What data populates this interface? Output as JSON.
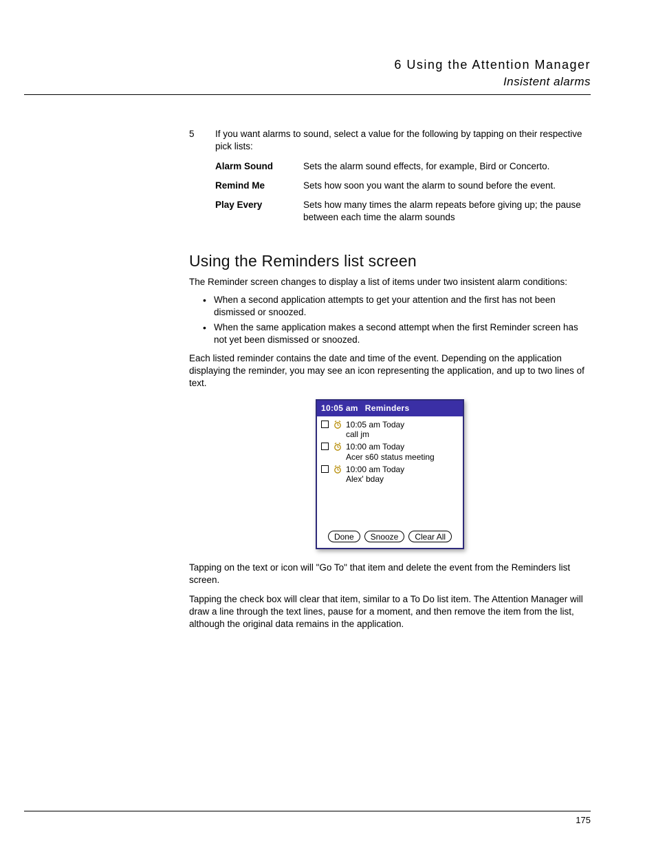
{
  "header": {
    "chapter": "6 Using the Attention Manager",
    "section": "Insistent alarms"
  },
  "step": {
    "num": "5",
    "text": "If you want alarms to sound, select a value for the following by tapping on their respective pick lists:"
  },
  "defs": [
    {
      "term": "Alarm Sound",
      "desc": "Sets the alarm sound effects, for example, Bird or Concerto."
    },
    {
      "term": "Remind Me",
      "desc": "Sets how soon you want the alarm to sound before the event."
    },
    {
      "term": "Play Every",
      "desc": "Sets how many times the alarm repeats before giving up; the pause between each time the alarm sounds"
    }
  ],
  "h2": "Using the Reminders list screen",
  "intro": "The Reminder screen changes to display a list of items under two insistent alarm conditions:",
  "bullets": [
    "When a second application attempts to get your attention and the first has not been dismissed or snoozed.",
    "When the same application makes a second attempt when the first Reminder screen has not yet been dismissed or snoozed."
  ],
  "para_after_bullets": "Each listed reminder contains the date and time of the event. Depending on the application displaying the reminder, you may see an icon representing the application, and up to two lines of text.",
  "palm": {
    "title_time": "10:05 am",
    "title_label": "Reminders",
    "items": [
      {
        "time": "10:05 am Today",
        "desc": "call jm"
      },
      {
        "time": "10:00 am Today",
        "desc": "Acer s60 status meeting"
      },
      {
        "time": "10:00 am Today",
        "desc": "Alex' bday"
      }
    ],
    "btn_done": "Done",
    "btn_snooze": "Snooze",
    "btn_clear": "Clear All"
  },
  "para_goto": "Tapping on the text or icon will \"Go To\" that item and delete the event from the Reminders list screen.",
  "para_checkbox": "Tapping the check box will clear that item, similar to a To Do list item. The Attention Manager will draw a line through the text lines, pause for a moment, and then remove the item from the list, although the original data remains in the application.",
  "page_num": "175"
}
